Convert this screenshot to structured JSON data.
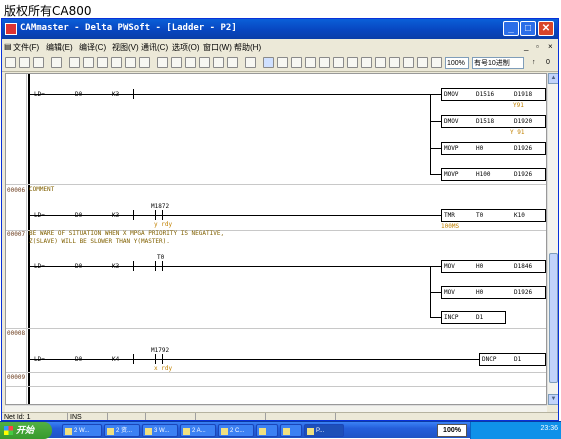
{
  "caption": "版权所有CA800",
  "window": {
    "title": "CAMmaster - Delta PWSoft - [Ladder - P2]",
    "controls": [
      "_",
      "□",
      "✕"
    ],
    "mdi_controls": [
      "_",
      "▫",
      "×"
    ]
  },
  "menu": [
    "文件(F)",
    "编辑(E)",
    "编译(C)",
    "视图(V)",
    "通讯(C)",
    "选项(O)",
    "窗口(W)",
    "帮助(H)"
  ],
  "toolbar": {
    "zoom": "100%",
    "radix": "有号10进制",
    "right_items": [
      "↑",
      "0"
    ]
  },
  "ladder": {
    "rows": [
      {
        "num": "",
        "contacts": [
          [
            "LD=",
            "D0",
            "K3"
          ]
        ],
        "outputs": [
          [
            "DMOV",
            "D1516",
            "D1918"
          ],
          [
            "DMOV",
            "D1518",
            "D1920"
          ],
          [
            "MOVP",
            "H0",
            "D1926"
          ],
          [
            "MOVP",
            "H100",
            "D1926"
          ]
        ],
        "output_comments": [
          "Y91",
          "Y 91"
        ]
      },
      {
        "num": "00006",
        "comment": "COMMENT",
        "contact": [
          "LD=",
          "D0",
          "K3"
        ],
        "extra": {
          "dev": "M1872",
          "sub": "y rdy"
        },
        "out": [
          "TMR",
          "T0",
          "K10"
        ],
        "out_sub": "100MS"
      },
      {
        "num": "00007",
        "comment1": "BE WARE OF SITUATION WHEN X MPGA PRIORITY IS NEGATIVE,",
        "comment2": "Z(SLAVE) WILL BE SLOWER THAN Y(MASTER).",
        "contact": [
          "LD=",
          "D0",
          "K3"
        ],
        "extra": {
          "dev": "T0"
        },
        "outs": [
          [
            "MOV",
            "H0",
            "D1846"
          ],
          [
            "MOV",
            "H0",
            "D1926"
          ],
          [
            "INCP",
            "D1",
            ""
          ]
        ]
      },
      {
        "num": "00008",
        "contact": [
          "LD=",
          "D0",
          "K4"
        ],
        "extra": {
          "dev": "M1792",
          "sub": "x rdy"
        },
        "out": [
          "DNCP",
          "D1",
          ""
        ]
      },
      {
        "num": "00009"
      }
    ]
  },
  "statusbar": {
    "net": "Net Id: 1",
    "mode": "INS"
  },
  "taskbar": {
    "start": "开始",
    "tasks": [
      "2 W...",
      "2 资...",
      "3 W...",
      "2 A...",
      "2 C...",
      "",
      "",
      "P..."
    ],
    "zoom": "100%",
    "clock": "23:36"
  }
}
